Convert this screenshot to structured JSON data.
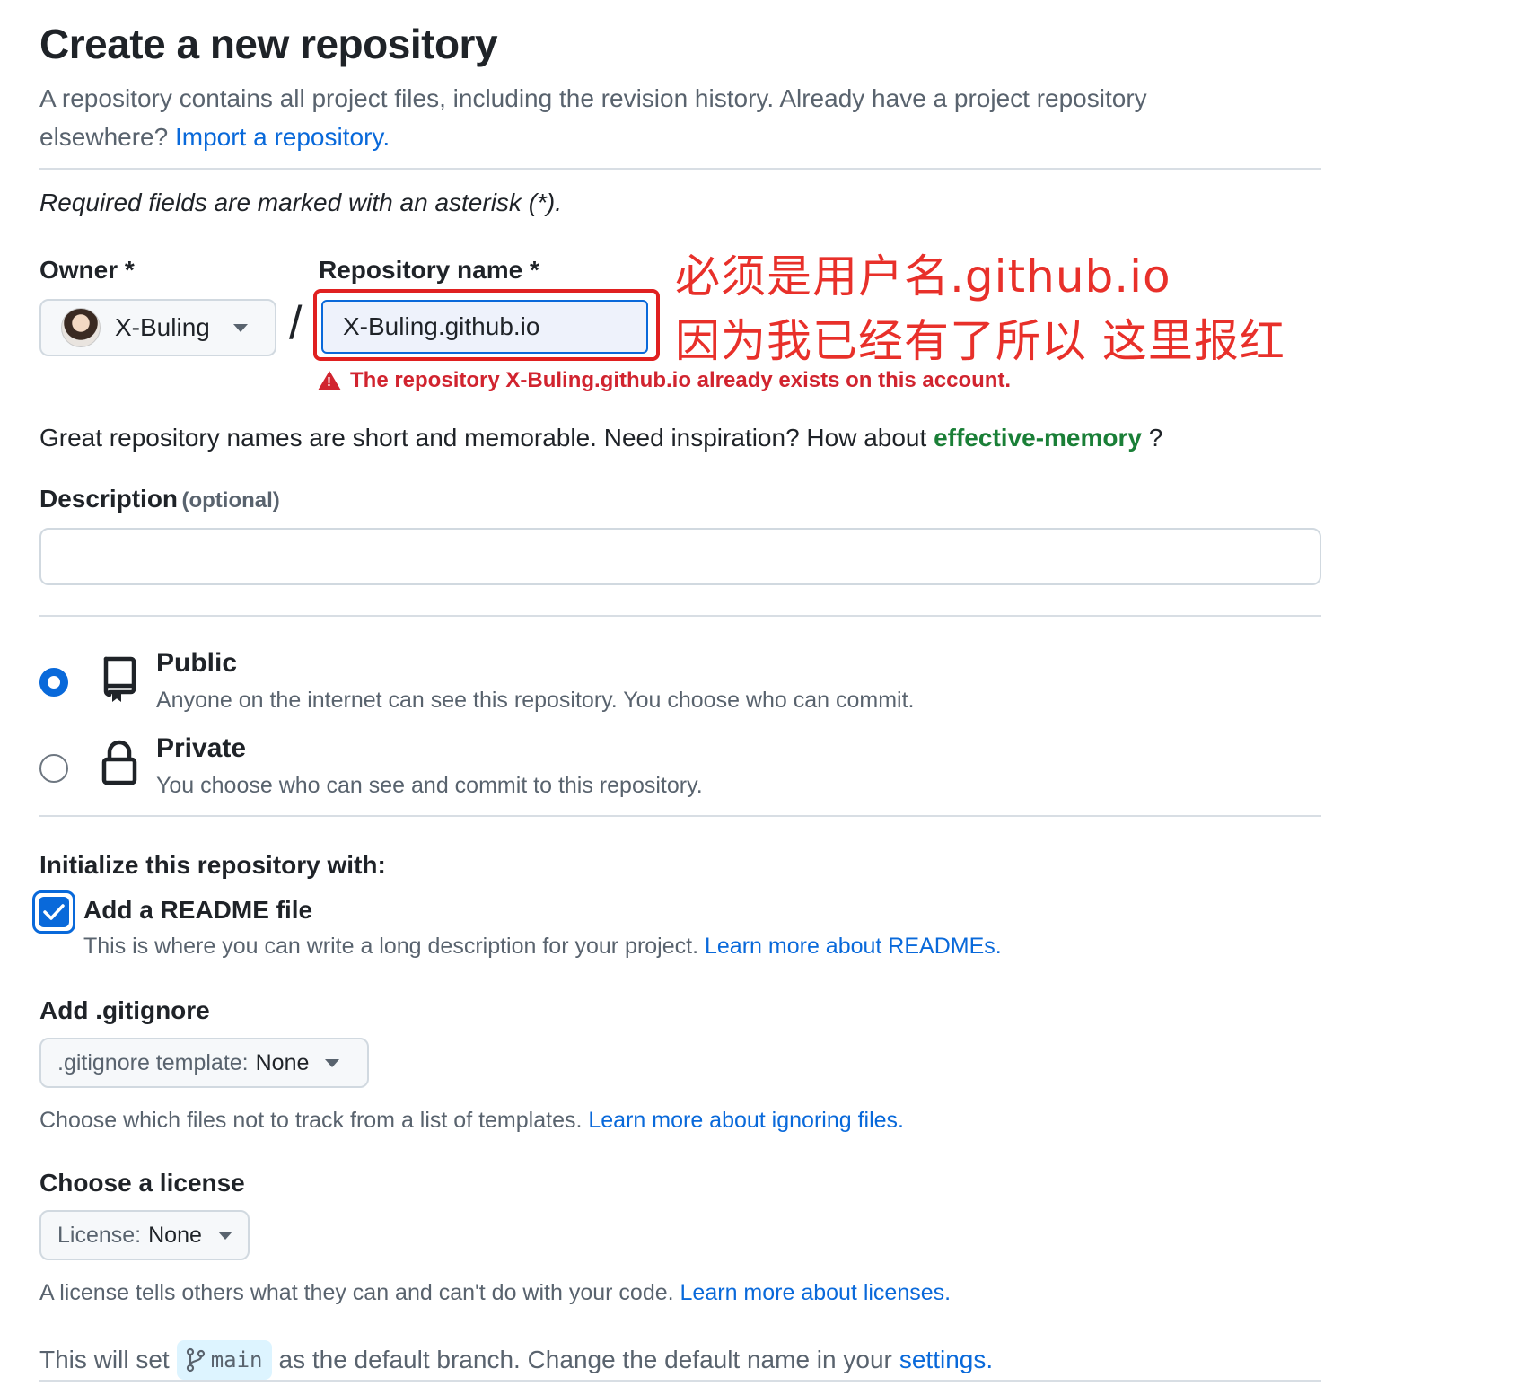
{
  "header": {
    "title": "Create a new repository",
    "subtitle_text": "A repository contains all project files, including the revision history. Already have a project repository elsewhere?",
    "import_link": "Import a repository."
  },
  "form": {
    "required_note": "Required fields are marked with an asterisk (*).",
    "owner_label": "Owner *",
    "owner_value": "X-Buling",
    "slash": "/",
    "repo_name_label": "Repository name *",
    "repo_name_value": "X-Buling.github.io",
    "error_message": "The repository X-Buling.github.io already exists on this account.",
    "inspiration_text": "Great repository names are short and memorable. Need inspiration? How about",
    "suggested_name": "effective-memory",
    "inspiration_end": "?",
    "description_label": "Description",
    "description_optional": "(optional)",
    "description_value": ""
  },
  "annotation": {
    "line1": "必须是用户名.github.io",
    "line2": "因为我已经有了所以 这里报红",
    "color": "#e8302a"
  },
  "visibility": {
    "selected": "public",
    "options": [
      {
        "title": "Public",
        "description": "Anyone on the internet can see this repository. You choose who can commit."
      },
      {
        "title": "Private",
        "description": "You choose who can see and commit to this repository."
      }
    ]
  },
  "initialize": {
    "heading": "Initialize this repository with:",
    "readme_label": "Add a README file",
    "readme_checked": true,
    "readme_help": "This is where you can write a long description for your project.",
    "readme_link": "Learn more about READMEs."
  },
  "gitignore": {
    "heading": "Add .gitignore",
    "select_prefix": ".gitignore template:",
    "select_value": "None",
    "help": "Choose which files not to track from a list of templates.",
    "link": "Learn more about ignoring files."
  },
  "license": {
    "heading": "Choose a license",
    "select_prefix": "License:",
    "select_value": "None",
    "help": "A license tells others what they can and can't do with your code.",
    "link": "Learn more about licenses."
  },
  "branch": {
    "prefix": "This will set",
    "name": "main",
    "suffix": "as the default branch. Change the default name in your",
    "settings_link": "settings."
  },
  "icons": {
    "repo": "repo-icon",
    "lock": "lock-icon",
    "warning": "alert-icon",
    "branch": "git-branch-icon"
  },
  "colors": {
    "link": "#0969da",
    "error": "#d1242f",
    "suggestion": "#1a7f37",
    "accent": "#0969da"
  }
}
